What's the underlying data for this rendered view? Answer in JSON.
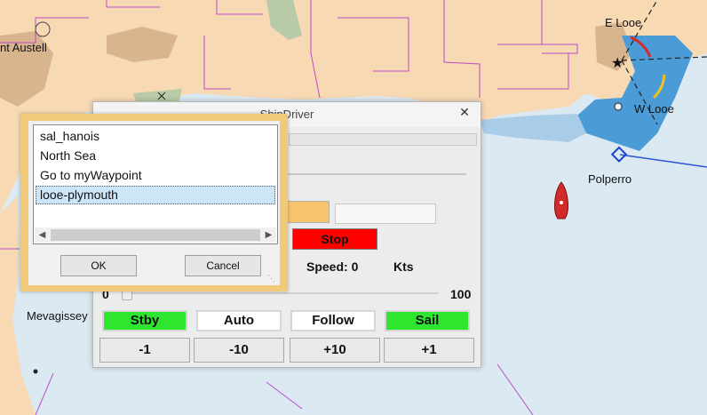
{
  "chart": {
    "places": [
      "nt Austell",
      "E Looe",
      "W Looe",
      "Polperro",
      "Mevagissey"
    ]
  },
  "shipdriver": {
    "title": "ShipDriver",
    "close_label": "✕",
    "stop_label": "Stop",
    "speed_label": "Speed: 0",
    "speed_unit": "Kts",
    "scale_min": "0",
    "scale_max": "100",
    "modes": [
      {
        "label": "Stby",
        "color": "#2ee62e"
      },
      {
        "label": "Auto",
        "color": "#ffffff"
      },
      {
        "label": "Follow",
        "color": "#ffffff"
      },
      {
        "label": "Sail",
        "color": "#2ee62e"
      }
    ],
    "steps": [
      "-1",
      "-10",
      "+10",
      "+1"
    ]
  },
  "route_dialog": {
    "routes": [
      "sal_hanois",
      "North Sea",
      "Go to myWaypoint",
      "looe-plymouth"
    ],
    "selected_index": 3,
    "ok_label": "OK",
    "cancel_label": "Cancel",
    "scroll_left_icon": "chevron-left-icon",
    "scroll_right_icon": "chevron-right-icon"
  }
}
